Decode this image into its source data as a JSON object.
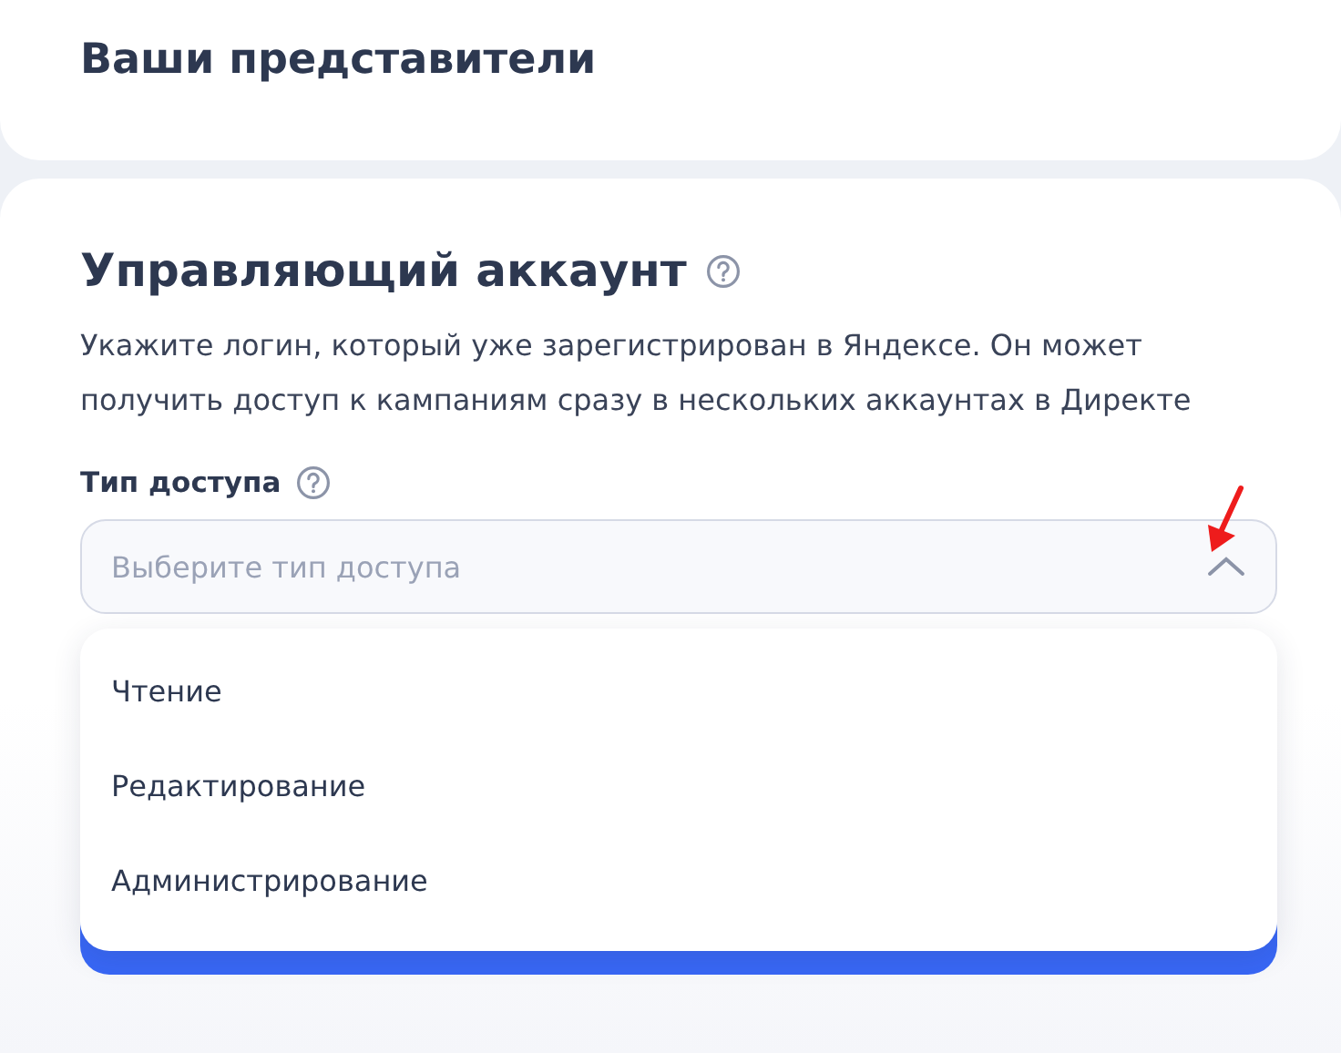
{
  "header_card": {
    "title": "Ваши представители"
  },
  "section": {
    "title": "Управляющий аккаунт",
    "description": "Укажите логин, который уже зарегистрирован в Яндексе. Он может получить доступ к кампаниям сразу в нескольких аккаунтах в Директе"
  },
  "access_type": {
    "label": "Тип доступа",
    "placeholder": "Выберите тип доступа",
    "expanded": true,
    "options": [
      {
        "label": "Чтение",
        "selected": false
      },
      {
        "label": "Редактирование",
        "selected": false
      },
      {
        "label": "Администрирование",
        "selected": false
      }
    ]
  }
}
